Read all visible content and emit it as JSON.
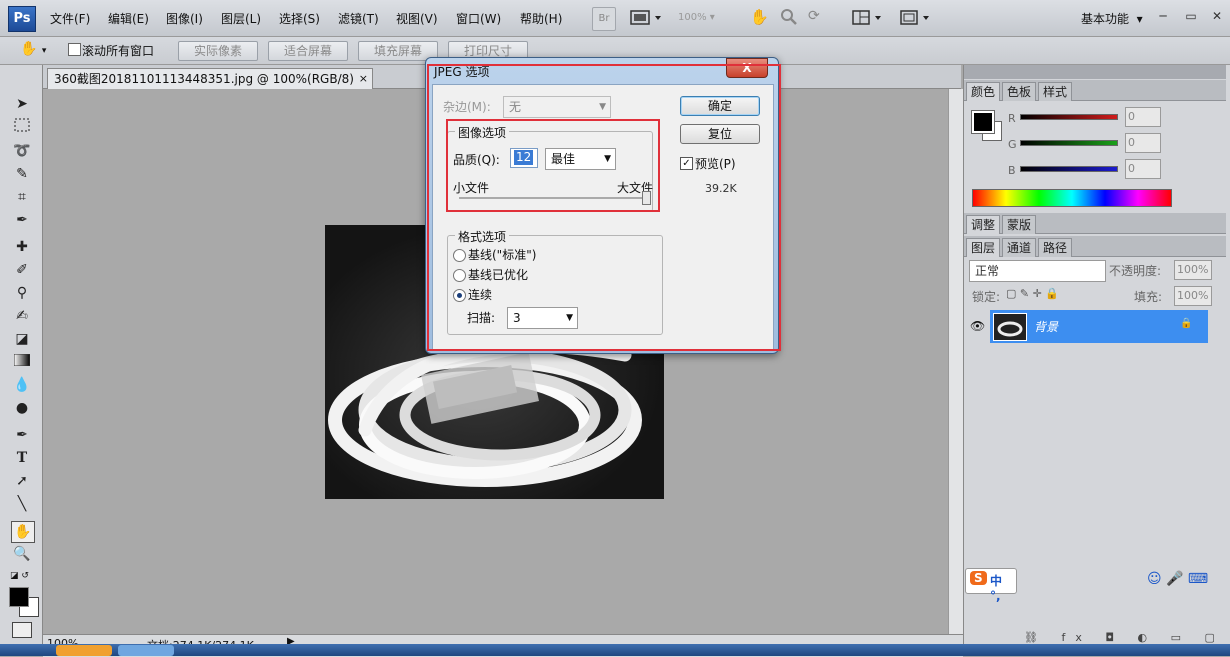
{
  "app": {
    "logo": "Ps"
  },
  "menubar": {
    "items": [
      "文件(F)",
      "编辑(E)",
      "图像(I)",
      "图层(L)",
      "选择(S)",
      "滤镜(T)",
      "视图(V)",
      "窗口(W)",
      "帮助(H)"
    ],
    "br_label": "Br",
    "zoom_value": "100%",
    "workspace": "基本功能"
  },
  "optionsbar": {
    "scroll_all_label": "滚动所有窗口",
    "actual_pixels": "实际像素",
    "fit_screen": "适合屏幕",
    "fill_screen": "填充屏幕",
    "print_size": "打印尺寸"
  },
  "document": {
    "tab_title": "360截图20181101113448351.jpg @ 100%(RGB/8)",
    "status_zoom": "100%",
    "status_doc": "文档:274.1K/274.1K"
  },
  "panels": {
    "color_tabs": [
      "颜色",
      "色板",
      "样式"
    ],
    "color_channels": [
      {
        "label": "R",
        "value": "0",
        "color": "#d11b1b"
      },
      {
        "label": "G",
        "value": "0",
        "color": "#1aa11a"
      },
      {
        "label": "B",
        "value": "0",
        "color": "#1b1bd1"
      }
    ],
    "adjust_tabs": [
      "调整",
      "蒙版"
    ],
    "layer_tabs": [
      "图层",
      "通道",
      "路径"
    ],
    "blend_mode": "正常",
    "opacity_label": "不透明度:",
    "opacity_value": "100%",
    "lock_label": "锁定:",
    "fill_label": "填充:",
    "fill_value": "100%",
    "layer_name": "背景"
  },
  "dialog": {
    "title": "JPEG 选项",
    "close": "X",
    "matte_label": "杂边(M):",
    "matte_value": "无",
    "ok": "确定",
    "reset": "复位",
    "preview_label": "预览(P)",
    "file_size": "39.2K",
    "image_options_title": "图像选项",
    "quality_label": "品质(Q):",
    "quality_value": "12",
    "quality_preset": "最佳",
    "small_file": "小文件",
    "large_file": "大文件",
    "quality_fraction": 1.0,
    "format_title": "格式选项",
    "format_options": [
      "基线(\"标准\")",
      "基线已优化",
      "连续"
    ],
    "format_selected": 2,
    "scan_label": "扫描:",
    "scan_value": "3"
  },
  "ime": {
    "logo": "S",
    "text": "中 °,"
  }
}
